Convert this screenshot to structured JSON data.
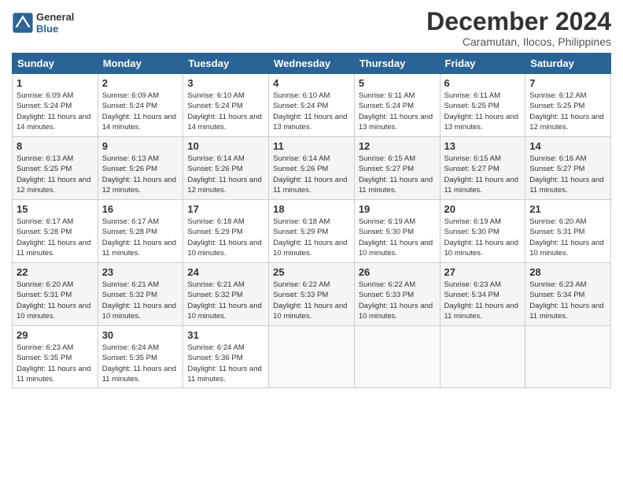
{
  "header": {
    "logo_general": "General",
    "logo_blue": "Blue",
    "month_title": "December 2024",
    "location": "Caramutan, Ilocos, Philippines"
  },
  "days_of_week": [
    "Sunday",
    "Monday",
    "Tuesday",
    "Wednesday",
    "Thursday",
    "Friday",
    "Saturday"
  ],
  "weeks": [
    [
      {
        "day": 1,
        "sunrise": "6:09 AM",
        "sunset": "5:24 PM",
        "daylight": "11 hours and 14 minutes."
      },
      {
        "day": 2,
        "sunrise": "6:09 AM",
        "sunset": "5:24 PM",
        "daylight": "11 hours and 14 minutes."
      },
      {
        "day": 3,
        "sunrise": "6:10 AM",
        "sunset": "5:24 PM",
        "daylight": "11 hours and 14 minutes."
      },
      {
        "day": 4,
        "sunrise": "6:10 AM",
        "sunset": "5:24 PM",
        "daylight": "11 hours and 13 minutes."
      },
      {
        "day": 5,
        "sunrise": "6:11 AM",
        "sunset": "5:24 PM",
        "daylight": "11 hours and 13 minutes."
      },
      {
        "day": 6,
        "sunrise": "6:11 AM",
        "sunset": "5:25 PM",
        "daylight": "11 hours and 13 minutes."
      },
      {
        "day": 7,
        "sunrise": "6:12 AM",
        "sunset": "5:25 PM",
        "daylight": "11 hours and 12 minutes."
      }
    ],
    [
      {
        "day": 8,
        "sunrise": "6:13 AM",
        "sunset": "5:25 PM",
        "daylight": "11 hours and 12 minutes."
      },
      {
        "day": 9,
        "sunrise": "6:13 AM",
        "sunset": "5:26 PM",
        "daylight": "11 hours and 12 minutes."
      },
      {
        "day": 10,
        "sunrise": "6:14 AM",
        "sunset": "5:26 PM",
        "daylight": "11 hours and 12 minutes."
      },
      {
        "day": 11,
        "sunrise": "6:14 AM",
        "sunset": "5:26 PM",
        "daylight": "11 hours and 11 minutes."
      },
      {
        "day": 12,
        "sunrise": "6:15 AM",
        "sunset": "5:27 PM",
        "daylight": "11 hours and 11 minutes."
      },
      {
        "day": 13,
        "sunrise": "6:15 AM",
        "sunset": "5:27 PM",
        "daylight": "11 hours and 11 minutes."
      },
      {
        "day": 14,
        "sunrise": "6:16 AM",
        "sunset": "5:27 PM",
        "daylight": "11 hours and 11 minutes."
      }
    ],
    [
      {
        "day": 15,
        "sunrise": "6:17 AM",
        "sunset": "5:28 PM",
        "daylight": "11 hours and 11 minutes."
      },
      {
        "day": 16,
        "sunrise": "6:17 AM",
        "sunset": "5:28 PM",
        "daylight": "11 hours and 11 minutes."
      },
      {
        "day": 17,
        "sunrise": "6:18 AM",
        "sunset": "5:29 PM",
        "daylight": "11 hours and 10 minutes."
      },
      {
        "day": 18,
        "sunrise": "6:18 AM",
        "sunset": "5:29 PM",
        "daylight": "11 hours and 10 minutes."
      },
      {
        "day": 19,
        "sunrise": "6:19 AM",
        "sunset": "5:30 PM",
        "daylight": "11 hours and 10 minutes."
      },
      {
        "day": 20,
        "sunrise": "6:19 AM",
        "sunset": "5:30 PM",
        "daylight": "11 hours and 10 minutes."
      },
      {
        "day": 21,
        "sunrise": "6:20 AM",
        "sunset": "5:31 PM",
        "daylight": "11 hours and 10 minutes."
      }
    ],
    [
      {
        "day": 22,
        "sunrise": "6:20 AM",
        "sunset": "5:31 PM",
        "daylight": "11 hours and 10 minutes."
      },
      {
        "day": 23,
        "sunrise": "6:21 AM",
        "sunset": "5:32 PM",
        "daylight": "11 hours and 10 minutes."
      },
      {
        "day": 24,
        "sunrise": "6:21 AM",
        "sunset": "5:32 PM",
        "daylight": "11 hours and 10 minutes."
      },
      {
        "day": 25,
        "sunrise": "6:22 AM",
        "sunset": "5:33 PM",
        "daylight": "11 hours and 10 minutes."
      },
      {
        "day": 26,
        "sunrise": "6:22 AM",
        "sunset": "5:33 PM",
        "daylight": "11 hours and 10 minutes."
      },
      {
        "day": 27,
        "sunrise": "6:23 AM",
        "sunset": "5:34 PM",
        "daylight": "11 hours and 11 minutes."
      },
      {
        "day": 28,
        "sunrise": "6:23 AM",
        "sunset": "5:34 PM",
        "daylight": "11 hours and 11 minutes."
      }
    ],
    [
      {
        "day": 29,
        "sunrise": "6:23 AM",
        "sunset": "5:35 PM",
        "daylight": "11 hours and 11 minutes."
      },
      {
        "day": 30,
        "sunrise": "6:24 AM",
        "sunset": "5:35 PM",
        "daylight": "11 hours and 11 minutes."
      },
      {
        "day": 31,
        "sunrise": "6:24 AM",
        "sunset": "5:36 PM",
        "daylight": "11 hours and 11 minutes."
      },
      null,
      null,
      null,
      null
    ]
  ]
}
